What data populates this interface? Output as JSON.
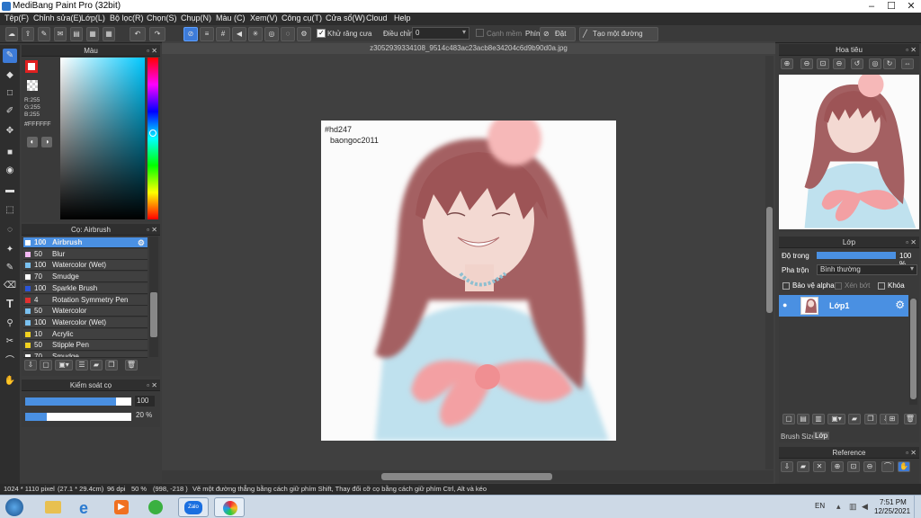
{
  "window": {
    "title": "MediBang Paint Pro (32bit)"
  },
  "menu": [
    "Tệp(F)",
    "Chỉnh sửa(E)",
    "Lớp(L)",
    "Bộ lọc(R)",
    "Chọn(S)",
    "Chụp(N)",
    "Màu (C)",
    "Xem(V)",
    "Công cụ(T)",
    "Cửa sổ(W)",
    "Cloud",
    "Help"
  ],
  "toolbar": {
    "antialias_label": "Khử răng cưa",
    "adjust_label": "Điều chỉnh",
    "adjust_value": "0",
    "smooth_edge_label": "Cạnh mềm",
    "key_label": "Phím",
    "reset_label": "Đặt lại",
    "line_label": "Tạo một đường thẳng"
  },
  "document": {
    "tab_name": "z3052939334108_9514c483ac23acb8e34204c6d9b90d0a.jpg"
  },
  "canvas_text": {
    "line1": "#hd247",
    "line2": "baongoc2011"
  },
  "color_panel": {
    "title": "Màu",
    "r": "R:255",
    "g": "G:255",
    "b": "B:255",
    "hex": "#FFFFFF",
    "fg_color": "#e02020",
    "bg_color": "#ffffff"
  },
  "brush_panel": {
    "title": "Cọ: Airbrush",
    "brushes": [
      {
        "size": "100",
        "name": "Airbrush",
        "color": "#ffffff"
      },
      {
        "size": "50",
        "name": "Blur",
        "color": "#f2b8f2"
      },
      {
        "size": "100",
        "name": "Watercolor (Wet)",
        "color": "#7ac1f0"
      },
      {
        "size": "70",
        "name": "Smudge",
        "color": "#ffffff"
      },
      {
        "size": "100",
        "name": "Sparkle Brush",
        "color": "#2a55d8"
      },
      {
        "size": "4",
        "name": "Rotation Symmetry Pen",
        "color": "#e03030"
      },
      {
        "size": "50",
        "name": "Watercolor",
        "color": "#7ac1f0"
      },
      {
        "size": "100",
        "name": "Watercolor (Wet)",
        "color": "#7ac1f0"
      },
      {
        "size": "10",
        "name": "Acrylic",
        "color": "#f0d020"
      },
      {
        "size": "50",
        "name": "Stipple Pen",
        "color": "#f0d020"
      },
      {
        "size": "70",
        "name": "Smudge",
        "color": "#ffffff"
      }
    ]
  },
  "brush_control": {
    "title": "Kiểm soát cọ",
    "size_value": "100",
    "opacity_value": "20 %",
    "size_fill": 0.86,
    "opacity_fill": 0.2
  },
  "navigator": {
    "title": "Hoa tiêu"
  },
  "layer_panel": {
    "title": "Lớp",
    "opacity_label": "Độ trong",
    "opacity_value": "100 %",
    "opacity_fill": 1.0,
    "blend_label": "Pha trộn",
    "blend_value": "Bình thường",
    "protect_alpha": "Bảo vệ alpha",
    "clip": "Xén bớt",
    "lock": "Khóa",
    "layer_name": "Lớp1",
    "tabs": [
      "Brush Size",
      "Lớp"
    ]
  },
  "reference": {
    "title": "Reference"
  },
  "status": {
    "size": "1024 * 1110 pixel",
    "cm": "(27.1 * 29.4cm)",
    "dpi": "96 dpi",
    "zoom": "50 %",
    "coords": "(998, -218 )",
    "hint": "Vẽ một đường thẳng bằng cách giữ phím Shift, Thay đổi cỡ cọ bằng cách giữ phím Ctrl, Alt và kéo"
  },
  "taskbar": {
    "lang": "EN",
    "time": "7:51 PM",
    "date": "12/25/2021",
    "zalo_label": "Zalo"
  }
}
